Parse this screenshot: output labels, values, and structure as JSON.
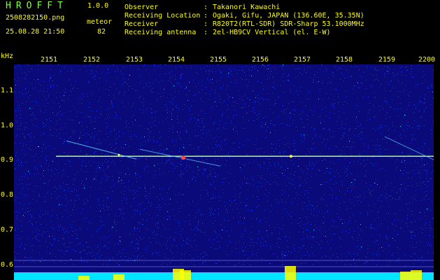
{
  "header": {
    "app_name": "HROFFT",
    "version": "1.0.0",
    "filename": "2508282150.png",
    "mode": "meteor",
    "timestamp": "25.08.28 21:50",
    "count": "82",
    "info": [
      {
        "label": "Observer",
        "value": "Takanori Kawachi"
      },
      {
        "label": "Receiving Location",
        "value": "Ogaki, Gifu, JAPAN (136.60E, 35.35N)"
      },
      {
        "label": "Receiver",
        "value": "R820T2(RTL-SDR) SDR-Sharp 53.1000MHz"
      },
      {
        "label": "Receiving antenna",
        "value": "2el-HB9CV Vertical (el. E-W)"
      }
    ]
  },
  "spectrogram": {
    "y_unit": "kHz",
    "x_ticks": [
      "2151",
      "2152",
      "2153",
      "2154",
      "2155",
      "2156",
      "2157",
      "2158",
      "2159",
      "2200"
    ],
    "y_ticks": [
      "1.1",
      "1.0",
      "0.9",
      "0.8",
      "0.7",
      "0.6"
    ],
    "carrier_khz": 0.91,
    "colors": {
      "background": "#0a0a7a",
      "noise": "#1e3cff",
      "carrier": "#aaff66",
      "power_fill": "#00e5ff",
      "power_peak": "#ffff00",
      "text_yellow": "#ffff00",
      "text_green": "#7fff3f"
    }
  }
}
